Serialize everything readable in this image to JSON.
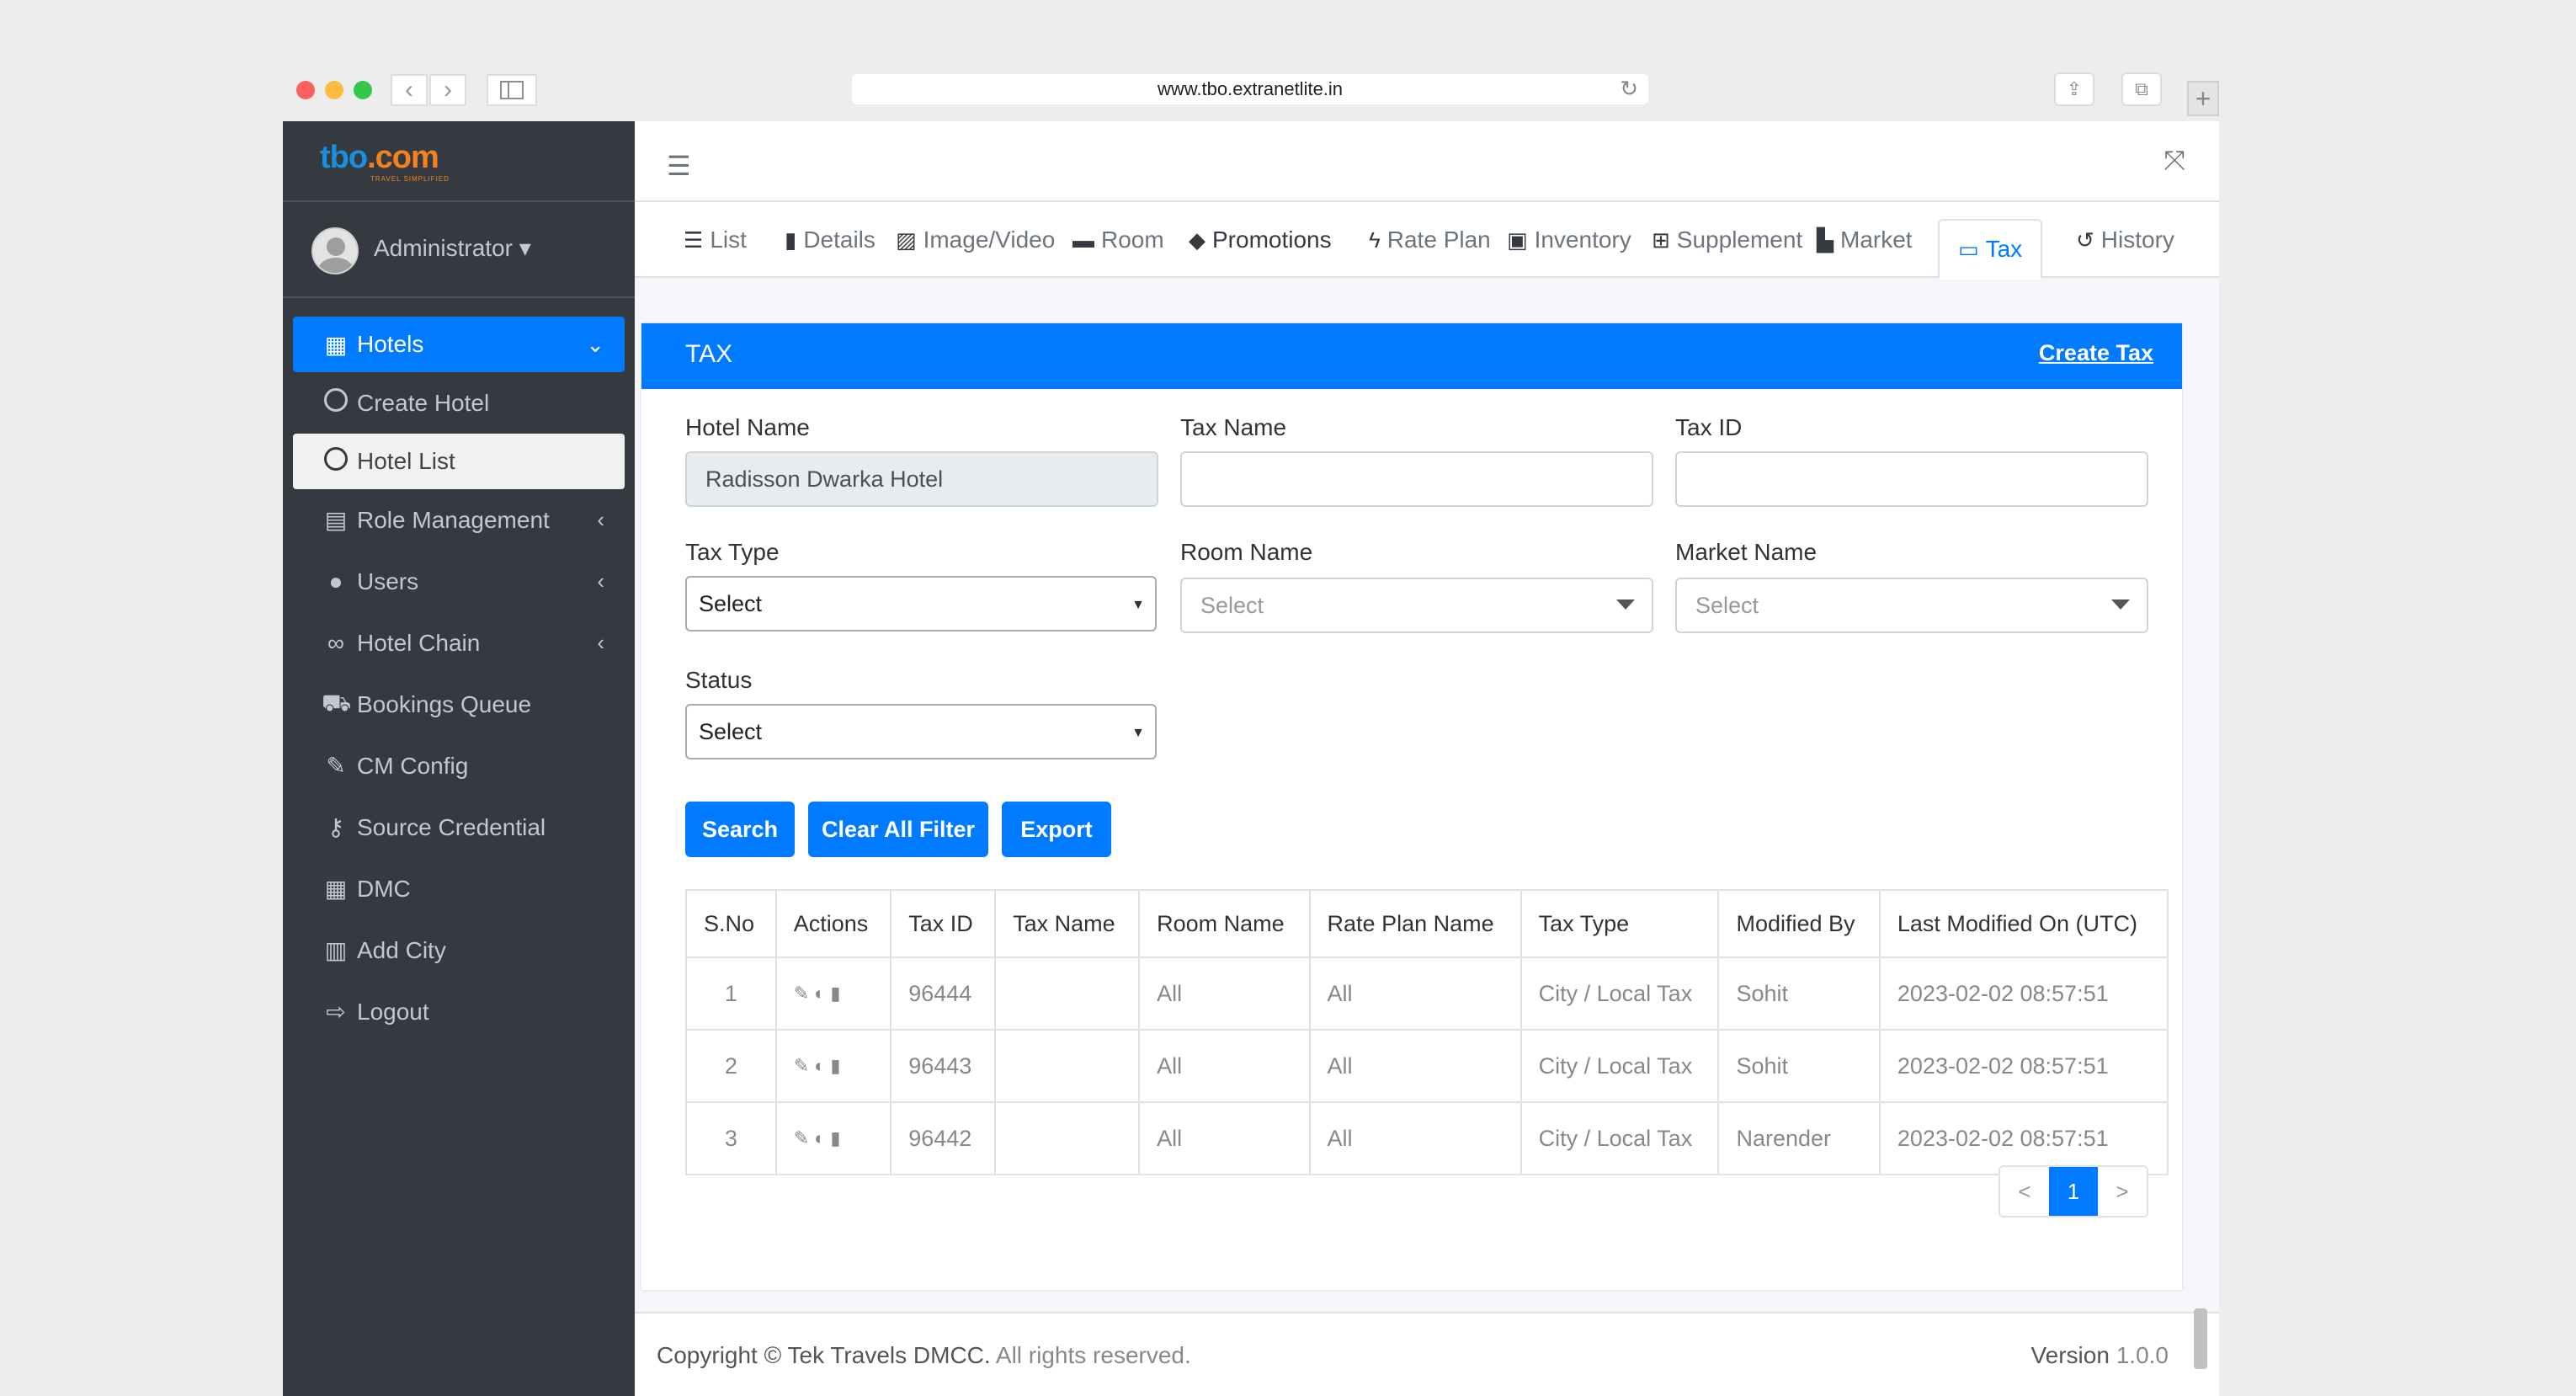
{
  "browser": {
    "url": "www.tbo.extranetlite.in"
  },
  "sidebar": {
    "logo_main": "tbo",
    "logo_dot": ".com",
    "logo_tagline": "TRAVEL SIMPLIFIED",
    "user": "Administrator",
    "items": [
      {
        "label": "Hotels",
        "icon": "building-icon",
        "state": "active",
        "arrow": "chevron-down"
      },
      {
        "label": "Create Hotel",
        "icon": "circle-icon",
        "state": "sub"
      },
      {
        "label": "Hotel List",
        "icon": "circle-icon",
        "state": "sub-active"
      },
      {
        "label": "Role Management",
        "icon": "clipboard-icon",
        "arrow": "chevron-left"
      },
      {
        "label": "Users",
        "icon": "user-icon",
        "arrow": "chevron-left"
      },
      {
        "label": "Hotel Chain",
        "icon": "link-icon",
        "arrow": "chevron-left"
      },
      {
        "label": "Bookings Queue",
        "icon": "cart-icon"
      },
      {
        "label": "CM Config",
        "icon": "brush-icon"
      },
      {
        "label": "Source Credential",
        "icon": "key-icon"
      },
      {
        "label": "DMC",
        "icon": "building-icon"
      },
      {
        "label": "Add City",
        "icon": "city-icon"
      },
      {
        "label": "Logout",
        "icon": "logout-icon"
      }
    ]
  },
  "tabs": [
    {
      "label": "List",
      "icon": "list-icon"
    },
    {
      "label": "Details",
      "icon": "file-icon"
    },
    {
      "label": "Image/Video",
      "icon": "image-icon"
    },
    {
      "label": "Room",
      "icon": "bed-icon"
    },
    {
      "label": "Promotions",
      "icon": "tags-icon"
    },
    {
      "label": "Rate Plan",
      "icon": "bolt-icon"
    },
    {
      "label": "Inventory",
      "icon": "boxes-icon"
    },
    {
      "label": "Supplement",
      "icon": "plus-square-icon"
    },
    {
      "label": "Market",
      "icon": "chart-area-icon"
    },
    {
      "label": "Tax",
      "icon": "money-icon",
      "active": true
    },
    {
      "label": "History",
      "icon": "history-icon"
    }
  ],
  "card": {
    "title": "TAX",
    "create_link": "Create Tax"
  },
  "form": {
    "hotel_name_label": "Hotel Name",
    "hotel_name_value": "Radisson Dwarka Hotel",
    "tax_name_label": "Tax Name",
    "tax_name_value": "",
    "tax_id_label": "Tax ID",
    "tax_id_value": "",
    "tax_type_label": "Tax Type",
    "tax_type_value": "Select",
    "room_name_label": "Room Name",
    "room_name_value": "Select",
    "market_name_label": "Market Name",
    "market_name_value": "Select",
    "status_label": "Status",
    "status_value": "Select"
  },
  "buttons": {
    "search": "Search",
    "clear": "Clear All Filter",
    "export": "Export"
  },
  "table": {
    "headers": [
      "S.No",
      "Actions",
      "Tax ID",
      "Tax Name",
      "Room Name",
      "Rate Plan Name",
      "Tax Type",
      "Modified By",
      "Last Modified On (UTC)"
    ],
    "rows": [
      {
        "sno": "1",
        "tax_id": "96444",
        "tax_name": "",
        "room": "All",
        "rate_plan": "All",
        "tax_type": "City / Local Tax",
        "modified_by": "Sohit",
        "modified_on": "2023-02-02 08:57:51"
      },
      {
        "sno": "2",
        "tax_id": "96443",
        "tax_name": "",
        "room": "All",
        "rate_plan": "All",
        "tax_type": "City / Local Tax",
        "modified_by": "Sohit",
        "modified_on": "2023-02-02 08:57:51"
      },
      {
        "sno": "3",
        "tax_id": "96442",
        "tax_name": "",
        "room": "All",
        "rate_plan": "All",
        "tax_type": "City / Local Tax",
        "modified_by": "Narender",
        "modified_on": "2023-02-02 08:57:51"
      }
    ]
  },
  "pagination": {
    "prev": "<",
    "current": "1",
    "next": ">"
  },
  "footer": {
    "copyright": "Copyright © Tek Travels DMCC.",
    "rights": "All rights reserved.",
    "version_label": "Version",
    "version_value": "1.0.0"
  },
  "colors": {
    "primary": "#007bff",
    "sidebar": "#343a40",
    "logo_blue": "#1a8fe0",
    "logo_orange": "#f58220"
  }
}
